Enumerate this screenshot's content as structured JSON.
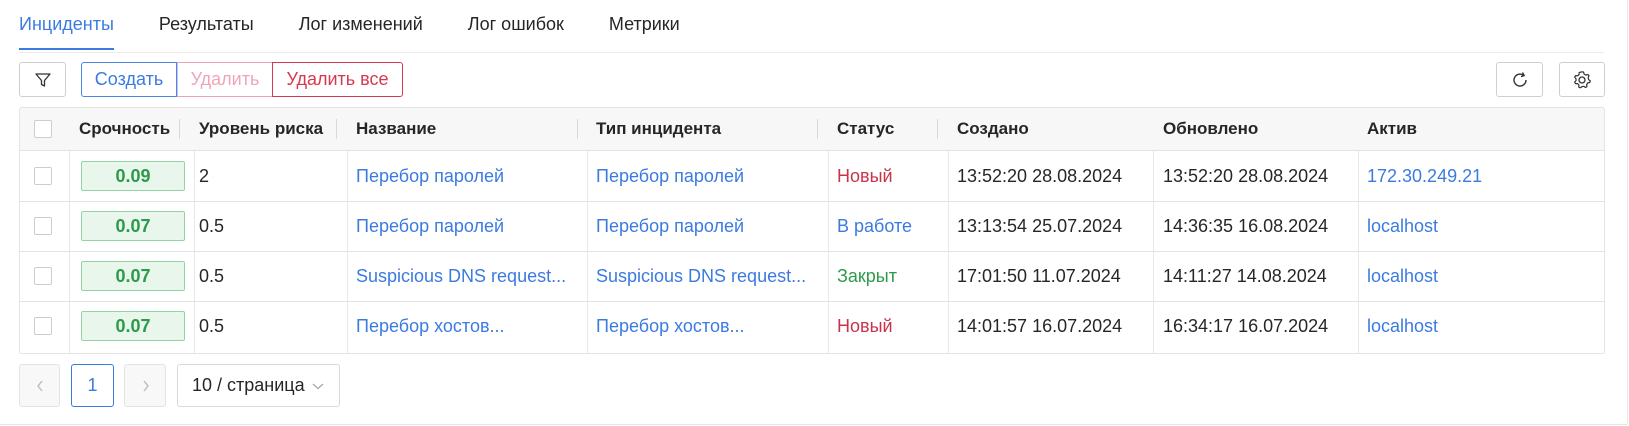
{
  "tabs": [
    {
      "label": "Инциденты",
      "active": true
    },
    {
      "label": "Результаты",
      "active": false
    },
    {
      "label": "Лог изменений",
      "active": false
    },
    {
      "label": "Лог ошибок",
      "active": false
    },
    {
      "label": "Метрики",
      "active": false
    }
  ],
  "toolbar": {
    "filter_icon": "filter-icon",
    "create_label": "Создать",
    "delete_label": "Удалить",
    "delete_all_label": "Удалить все",
    "refresh_icon": "refresh-icon",
    "settings_icon": "gear-icon"
  },
  "table": {
    "columns": [
      "Срочность",
      "Уровень риска",
      "Название",
      "Тип инцидента",
      "Статус",
      "Создано",
      "Обновлено",
      "Актив"
    ],
    "rows": [
      {
        "severity": "0.09",
        "risk": "2",
        "name": "Перебор паролей",
        "type": "Перебор паролей",
        "status": "Новый",
        "status_color": "#c8334a",
        "created": "13:52:20 28.08.2024",
        "updated": "13:52:20 28.08.2024",
        "asset": "172.30.249.21"
      },
      {
        "severity": "0.07",
        "risk": "0.5",
        "name": "Перебор паролей",
        "type": "Перебор паролей",
        "status": "В работе",
        "status_color": "#3b7be0",
        "created": "13:13:54 25.07.2024",
        "updated": "14:36:35 16.08.2024",
        "asset": "localhost"
      },
      {
        "severity": "0.07",
        "risk": "0.5",
        "name": "Suspicious DNS request...",
        "type": "Suspicious DNS request...",
        "status": "Закрыт",
        "status_color": "#2f9a4c",
        "created": "17:01:50 11.07.2024",
        "updated": "14:11:27 14.08.2024",
        "asset": "localhost"
      },
      {
        "severity": "0.07",
        "risk": "0.5",
        "name": "Перебор хостов...",
        "type": "Перебор хостов...",
        "status": "Новый",
        "status_color": "#c8334a",
        "created": "14:01:57 16.07.2024",
        "updated": "16:34:17 16.07.2024",
        "asset": "localhost"
      }
    ]
  },
  "pagination": {
    "current_page": "1",
    "page_size_label": "10 / страница",
    "prev_icon": "chevron-left-icon",
    "next_icon": "chevron-right-icon"
  },
  "colors": {
    "accent": "#3b7be0",
    "danger": "#d8384f",
    "success": "#2d9a4a"
  }
}
